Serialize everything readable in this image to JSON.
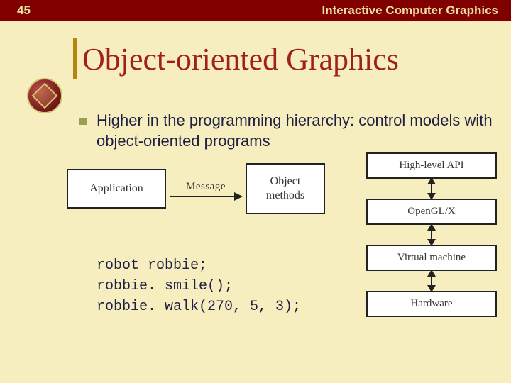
{
  "header": {
    "slide_number": "45",
    "course_title": "Interactive Computer Graphics"
  },
  "title": "Object-oriented Graphics",
  "bullet": {
    "text": "Higher in the programming hierarchy: control models with object-oriented programs"
  },
  "diagram_left": {
    "box_application": "Application",
    "arrow_label": "Message",
    "box_object": "Object\nmethods"
  },
  "code": {
    "line1": "robot robbie;",
    "line2": "robbie. smile();",
    "line3": "robbie. walk(270, 5, 3);"
  },
  "diagram_right": {
    "box1": "High-level API",
    "box2": "OpenGL/X",
    "box3": "Virtual machine",
    "box4": "Hardware"
  }
}
